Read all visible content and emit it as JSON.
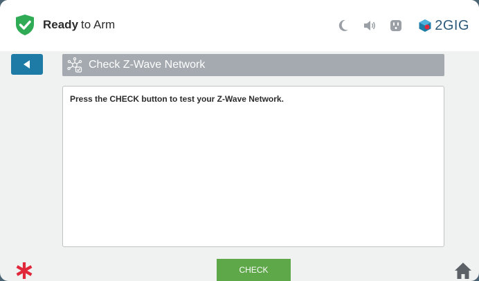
{
  "status": {
    "bold": "Ready",
    "rest": "to Arm"
  },
  "logo": {
    "text": "2GIG"
  },
  "page": {
    "title": "Check Z-Wave Network"
  },
  "content": {
    "message": "Press the CHECK button to test your Z-Wave Network."
  },
  "footer": {
    "check_label": "CHECK"
  },
  "icons": {
    "status": "shield-check-icon",
    "night": "moon-icon",
    "sound": "speaker-icon",
    "power": "outlet-icon",
    "back": "back-arrow-icon",
    "zwave": "network-icon",
    "panic": "asterisk-icon",
    "home": "home-icon"
  },
  "colors": {
    "status_green": "#2faa55",
    "accent_blue": "#1e7ba6",
    "check_green": "#5ea84a",
    "panic_red": "#e0283a"
  }
}
